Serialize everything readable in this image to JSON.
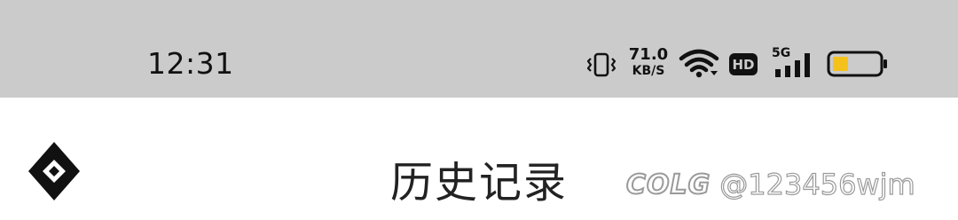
{
  "status_bar": {
    "time": "12:31",
    "net_speed_value": "71.0",
    "net_speed_unit": "KB/S",
    "hd_label": "HD",
    "network_type": "5G",
    "battery_color": "#f4c21b",
    "icons": [
      "vibrate-icon",
      "wifi-icon",
      "hd-badge",
      "signal-icon",
      "battery-icon"
    ]
  },
  "app_bar": {
    "title": "历史记录",
    "back_icon": "diamond-logo-icon"
  },
  "watermark": {
    "logo": "COLG",
    "handle": "@123456wjm"
  }
}
